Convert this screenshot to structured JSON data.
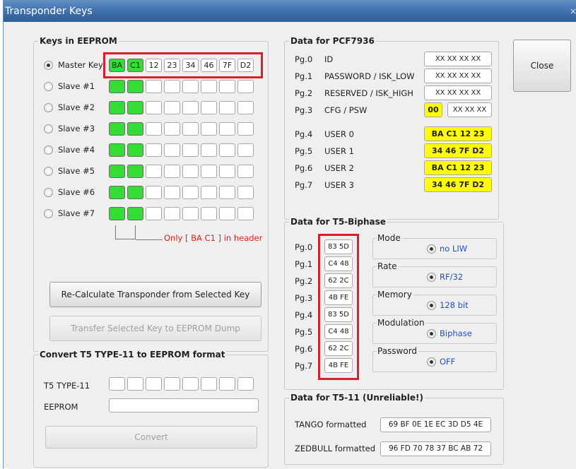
{
  "window": {
    "title": "Transponder Keys",
    "close_glyph": "×"
  },
  "close_button": "Close",
  "keys": {
    "title": "Keys in EEPROM",
    "rows": [
      {
        "label": "Master Key",
        "selected": true,
        "cells": [
          "BA",
          "C1",
          "12",
          "23",
          "34",
          "46",
          "7F",
          "D2"
        ]
      },
      {
        "label": "Slave #1",
        "selected": false,
        "cells": [
          "",
          "",
          "",
          "",
          "",
          "",
          "",
          ""
        ]
      },
      {
        "label": "Slave #2",
        "selected": false,
        "cells": [
          "",
          "",
          "",
          "",
          "",
          "",
          "",
          ""
        ]
      },
      {
        "label": "Slave #3",
        "selected": false,
        "cells": [
          "",
          "",
          "",
          "",
          "",
          "",
          "",
          ""
        ]
      },
      {
        "label": "Slave #4",
        "selected": false,
        "cells": [
          "",
          "",
          "",
          "",
          "",
          "",
          "",
          ""
        ]
      },
      {
        "label": "Slave #5",
        "selected": false,
        "cells": [
          "",
          "",
          "",
          "",
          "",
          "",
          "",
          ""
        ]
      },
      {
        "label": "Slave #6",
        "selected": false,
        "cells": [
          "",
          "",
          "",
          "",
          "",
          "",
          "",
          ""
        ]
      },
      {
        "label": "Slave #7",
        "selected": false,
        "cells": [
          "",
          "",
          "",
          "",
          "",
          "",
          "",
          ""
        ]
      }
    ],
    "header_note": "Only [ BA C1 ] in header",
    "recalc_button": "Re-Calculate Transponder from Selected Key",
    "transfer_button": "Transfer Selected Key to EEPROM Dump"
  },
  "convert": {
    "title": "Convert T5 TYPE-11 to EEPROM format",
    "t5_label": "T5 TYPE-11",
    "eeprom_label": "EEPROM",
    "eeprom_value": "",
    "convert_button": "Convert"
  },
  "pcf": {
    "title": "Data for PCF7936",
    "rows": [
      {
        "page": "Pg.0",
        "name": "ID",
        "value": "XX XX XX XX"
      },
      {
        "page": "Pg.1",
        "name": "PASSWORD / ISK_LOW",
        "value": "XX XX XX XX"
      },
      {
        "page": "Pg.2",
        "name": "RESERVED / ISK_HIGH",
        "value": "XX XX XX XX"
      },
      {
        "page": "Pg.3",
        "name": "CFG / PSW",
        "value": "XX XX XX",
        "prefix": "00"
      },
      {
        "page": "Pg.4",
        "name": "USER 0",
        "value": "BA C1 12 23"
      },
      {
        "page": "Pg.5",
        "name": "USER 1",
        "value": "34 46 7F D2"
      },
      {
        "page": "Pg.6",
        "name": "USER 2",
        "value": "BA C1 12 23"
      },
      {
        "page": "Pg.7",
        "name": "USER 3",
        "value": "34 46 7F D2"
      }
    ]
  },
  "t5": {
    "title": "Data for T5-Biphase",
    "rows": [
      {
        "page": "Pg.0",
        "value": "83 5D"
      },
      {
        "page": "Pg.1",
        "value": "C4 48"
      },
      {
        "page": "Pg.2",
        "value": "62 2C"
      },
      {
        "page": "Pg.3",
        "value": "4B FE"
      },
      {
        "page": "Pg.4",
        "value": "83 5D"
      },
      {
        "page": "Pg.5",
        "value": "C4 48"
      },
      {
        "page": "Pg.6",
        "value": "62 2C"
      },
      {
        "page": "Pg.7",
        "value": "4B FE"
      }
    ],
    "options": [
      {
        "title": "Mode",
        "value": "no LIW"
      },
      {
        "title": "Rate",
        "value": "RF/32"
      },
      {
        "title": "Memory",
        "value": "128 bit"
      },
      {
        "title": "Modulation",
        "value": "Biphase"
      },
      {
        "title": "Password",
        "value": "OFF"
      }
    ]
  },
  "t511": {
    "title": "Data for T5-11 (Unreliable!)",
    "tango_label": "TANGO formatted",
    "tango_value": "69 BF 0E 1E EC 3D D5 4E",
    "zed_label": "ZEDBULL formatted",
    "zed_value": "96 FD 70 78 37 BC AB 72"
  },
  "colors": {
    "key_highlight": "#33dd33",
    "user_value_bg": "#ffff00",
    "callout": "#d6202b",
    "option_text": "#1f4fd0"
  }
}
